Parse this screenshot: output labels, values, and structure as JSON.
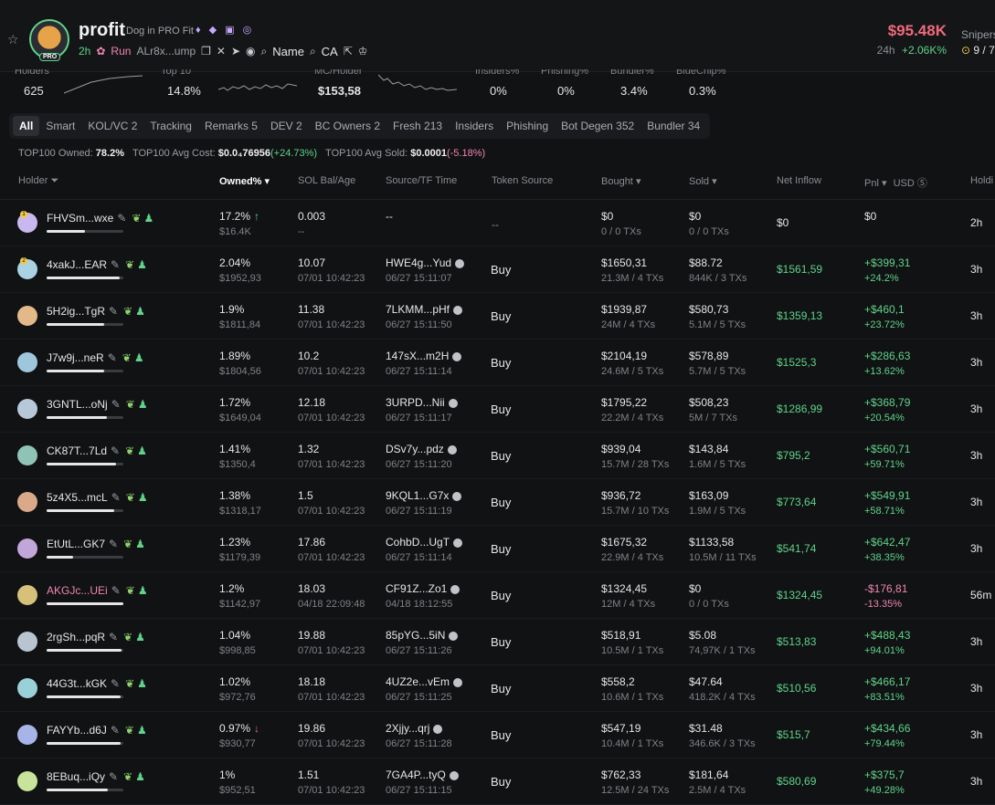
{
  "header": {
    "title": "profit",
    "subtitle": "Dog in PRO Fit",
    "age": "2h",
    "run_label": "Run",
    "address": "ALr8x...ump",
    "name_label": "Name",
    "ca_label": "CA",
    "logo_badge": "PRO",
    "price": "$95.48K",
    "change_period": "24h",
    "change_value": "+2.06K%",
    "snipers_label": "Snipers",
    "snipers_value": "9 / 7"
  },
  "stats": [
    {
      "label": "Holders",
      "value": "625"
    },
    {
      "label": "Top 10",
      "value": "14.8%"
    },
    {
      "label": "MC/Holder",
      "value": "$153,58"
    },
    {
      "label": "Insiders%",
      "value": "0%"
    },
    {
      "label": "Phishing%",
      "value": "0%"
    },
    {
      "label": "Bundler%",
      "value": "3.4%"
    },
    {
      "label": "BlueChip%",
      "value": "0.3%"
    }
  ],
  "tabs": [
    "All",
    "Smart",
    "KOL/VC 2",
    "Tracking",
    "Remarks 5",
    "DEV 2",
    "BC Owners 2",
    "Fresh 213",
    "Insiders",
    "Phishing",
    "Bot Degen 352",
    "Bundler 34"
  ],
  "summary": {
    "owned_label": "TOP100 Owned:",
    "owned": "78.2%",
    "cost_label": "TOP100 Avg Cost:",
    "cost": "$0.0₄76956",
    "cost_change": "(+24.73%)",
    "sold_label": "TOP100 Avg Sold:",
    "sold": "$0.0001",
    "sold_change": "(-5.18%)"
  },
  "columns": {
    "holder": "Holder",
    "owned": "Owned%",
    "sol": "SOL Bal/Age",
    "source": "Source/TF Time",
    "token_source": "Token Source",
    "bought": "Bought",
    "sold": "Sold",
    "net": "Net Inflow",
    "pnl": "Pnl",
    "usd": "USD",
    "hold": "Holdi"
  },
  "colors": {
    "accent_green": "#5fd38a",
    "accent_red": "#f06a7b",
    "accent_pink": "#ef86b0",
    "background": "#111214"
  },
  "rows": [
    {
      "rank": "1",
      "name": "FHVSm...wxe",
      "owned": "17.2%",
      "owned_usd": "$16.4K",
      "trend": "up",
      "sol": "0.003",
      "age": "--",
      "src": "--",
      "src_time": "",
      "token_source": "--",
      "bought": "$0",
      "bought_tx": "0 / 0 TXs",
      "sold": "$0",
      "sold_tx": "0 / 0 TXs",
      "net": "$0",
      "pnl": "$0",
      "pnl_pct": "",
      "hold": "2h",
      "bar_fraction": 0.5
    },
    {
      "rank": "2",
      "name": "4xakJ...EAR",
      "owned": "2.04%",
      "owned_usd": "$1952,93",
      "sol": "10.07",
      "age": "07/01 10:42:23",
      "src": "HWE4g...Yud",
      "src_time": "06/27 15:11:07",
      "token_source": "Buy",
      "bought": "$1650,31",
      "bought_tx": "21.3M / 4 TXs",
      "sold": "$88.72",
      "sold_tx": "844K / 3 TXs",
      "net": "$1561,59",
      "pnl": "+$399,31",
      "pnl_pct": "+24.2%",
      "hold": "3h",
      "bar_fraction": 0.95
    },
    {
      "rank": "",
      "name": "5H2ig...TgR",
      "owned": "1.9%",
      "owned_usd": "$1811,84",
      "sol": "11.38",
      "age": "07/01 10:42:23",
      "src": "7LKMM...pHf",
      "src_time": "06/27 15:11:50",
      "token_source": "Buy",
      "bought": "$1939,87",
      "bought_tx": "24M / 4 TXs",
      "sold": "$580,73",
      "sold_tx": "5.1M / 5 TXs",
      "net": "$1359,13",
      "pnl": "+$460,1",
      "pnl_pct": "+23.72%",
      "hold": "3h",
      "bar_fraction": 0.75
    },
    {
      "rank": "",
      "name": "J7w9j...neR",
      "owned": "1.89%",
      "owned_usd": "$1804,56",
      "sol": "10.2",
      "age": "07/01 10:42:23",
      "src": "147sX...m2H",
      "src_time": "06/27 15:11:14",
      "token_source": "Buy",
      "bought": "$2104,19",
      "bought_tx": "24.6M / 5 TXs",
      "sold": "$578,89",
      "sold_tx": "5.7M / 5 TXs",
      "net": "$1525,3",
      "pnl": "+$286,63",
      "pnl_pct": "+13.62%",
      "hold": "3h",
      "bar_fraction": 0.75
    },
    {
      "rank": "",
      "name": "3GNTL...oNj",
      "owned": "1.72%",
      "owned_usd": "$1649,04",
      "sol": "12.18",
      "age": "07/01 10:42:23",
      "src": "3URPD...Nii",
      "src_time": "06/27 15:11:17",
      "token_source": "Buy",
      "bought": "$1795,22",
      "bought_tx": "22.2M / 4 TXs",
      "sold": "$508,23",
      "sold_tx": "5M / 7 TXs",
      "net": "$1286,99",
      "pnl": "+$368,79",
      "pnl_pct": "+20.54%",
      "hold": "3h",
      "bar_fraction": 0.78
    },
    {
      "rank": "",
      "name": "CK87T...7Ld",
      "owned": "1.41%",
      "owned_usd": "$1350,4",
      "sol": "1.32",
      "age": "07/01 10:42:23",
      "src": "DSv7y...pdz",
      "src_time": "06/27 15:11:20",
      "token_source": "Buy",
      "bought": "$939,04",
      "bought_tx": "15.7M / 28 TXs",
      "sold": "$143,84",
      "sold_tx": "1.6M / 5 TXs",
      "net": "$795,2",
      "pnl": "+$560,71",
      "pnl_pct": "+59.71%",
      "hold": "3h",
      "bar_fraction": 0.9
    },
    {
      "rank": "",
      "name": "5z4X5...mcL",
      "owned": "1.38%",
      "owned_usd": "$1318,17",
      "sol": "1.5",
      "age": "07/01 10:42:23",
      "src": "9KQL1...G7x",
      "src_time": "06/27 15:11:19",
      "token_source": "Buy",
      "bought": "$936,72",
      "bought_tx": "15.7M / 10 TXs",
      "sold": "$163,09",
      "sold_tx": "1.9M / 5 TXs",
      "net": "$773,64",
      "pnl": "+$549,91",
      "pnl_pct": "+58.71%",
      "hold": "3h",
      "bar_fraction": 0.88
    },
    {
      "rank": "",
      "name": "EtUtL...GK7",
      "owned": "1.23%",
      "owned_usd": "$1179,39",
      "sol": "17.86",
      "age": "07/01 10:42:23",
      "src": "CohbD...UgT",
      "src_time": "06/27 15:11:14",
      "token_source": "Buy",
      "bought": "$1675,32",
      "bought_tx": "22.9M / 4 TXs",
      "sold": "$1133,58",
      "sold_tx": "10.5M / 11 TXs",
      "net": "$541,74",
      "pnl": "+$642,47",
      "pnl_pct": "+38.35%",
      "hold": "3h",
      "bar_fraction": 0.35
    },
    {
      "rank": "",
      "name": "AKGJc...UEi",
      "name_pink": true,
      "owned": "1.2%",
      "owned_usd": "$1142,97",
      "sol": "18.03",
      "age": "04/18 22:09:48",
      "src": "CF91Z...Zo1",
      "src_time": "04/18 18:12:55",
      "token_source": "Buy",
      "bought": "$1324,45",
      "bought_tx": "12M / 4 TXs",
      "sold": "$0",
      "sold_tx": "0 / 0 TXs",
      "net": "$1324,45",
      "pnl": "-$176,81",
      "pnl_pct": "-13.35%",
      "pnl_neg": true,
      "hold": "56m",
      "bar_fraction": 1.0
    },
    {
      "rank": "",
      "name": "2rgSh...pqR",
      "owned": "1.04%",
      "owned_usd": "$998,85",
      "sol": "19.88",
      "age": "07/01 10:42:23",
      "src": "85pYG...5iN",
      "src_time": "06/27 15:11:26",
      "token_source": "Buy",
      "bought": "$518,91",
      "bought_tx": "10.5M / 1 TXs",
      "sold": "$5.08",
      "sold_tx": "74,97K / 1 TXs",
      "net": "$513,83",
      "pnl": "+$488,43",
      "pnl_pct": "+94.01%",
      "hold": "3h",
      "bar_fraction": 0.98
    },
    {
      "rank": "",
      "name": "44G3t...kGK",
      "owned": "1.02%",
      "owned_usd": "$972,76",
      "sol": "18.18",
      "age": "07/01 10:42:23",
      "src": "4UZ2e...vEm",
      "src_time": "06/27 15:11:25",
      "token_source": "Buy",
      "bought": "$558,2",
      "bought_tx": "10.6M / 1 TXs",
      "sold": "$47.64",
      "sold_tx": "418.2K / 4 TXs",
      "net": "$510,56",
      "pnl": "+$466,17",
      "pnl_pct": "+83.51%",
      "hold": "3h",
      "bar_fraction": 0.97
    },
    {
      "rank": "",
      "name": "FAYYb...d6J",
      "owned": "0.97%",
      "owned_usd": "$930,77",
      "trend": "down",
      "sol": "19.86",
      "age": "07/01 10:42:23",
      "src": "2Xjjy...qrj",
      "src_time": "06/27 15:11:28",
      "token_source": "Buy",
      "bought": "$547,19",
      "bought_tx": "10.4M / 1 TXs",
      "sold": "$31.48",
      "sold_tx": "346.6K / 3 TXs",
      "net": "$515,7",
      "pnl": "+$434,66",
      "pnl_pct": "+79.44%",
      "hold": "3h",
      "bar_fraction": 0.97
    },
    {
      "rank": "",
      "name": "8EBuq...iQy",
      "owned": "1%",
      "owned_usd": "$952,51",
      "sol": "1.51",
      "age": "07/01 10:42:23",
      "src": "7GA4P...tyQ",
      "src_time": "06/27 15:11:15",
      "token_source": "Buy",
      "bought": "$762,33",
      "bought_tx": "12.5M / 24 TXs",
      "sold": "$181,64",
      "sold_tx": "2.5M / 4 TXs",
      "net": "$580,69",
      "pnl": "+$375,7",
      "pnl_pct": "+49.28%",
      "hold": "3h",
      "bar_fraction": 0.8
    }
  ]
}
